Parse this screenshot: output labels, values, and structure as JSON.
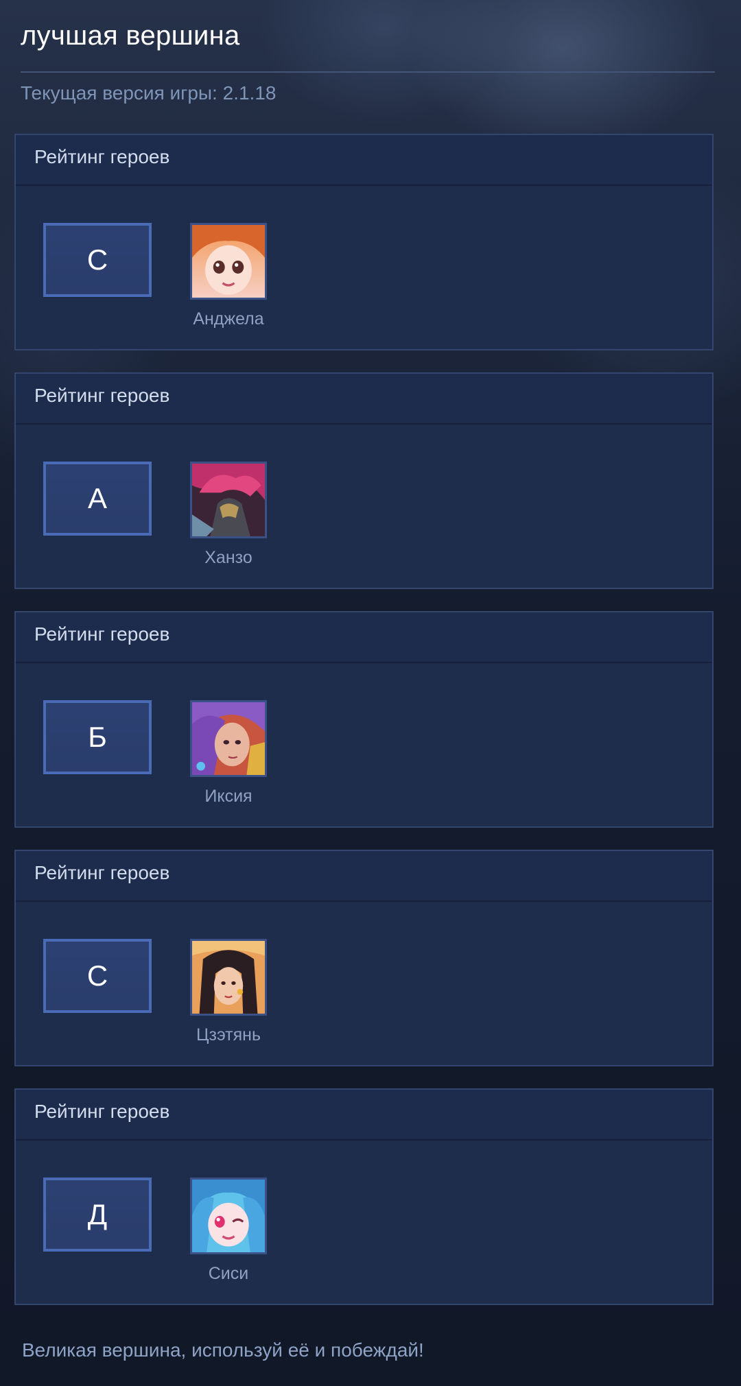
{
  "header": {
    "title": "лучшая вершина",
    "version_text": "Текущая версия игры: 2.1.18"
  },
  "cards": [
    {
      "title": "Рейтинг героев",
      "tier": "С",
      "hero": {
        "name": "Анджела",
        "portrait_icon": "angela-portrait"
      }
    },
    {
      "title": "Рейтинг героев",
      "tier": "А",
      "hero": {
        "name": "Ханзо",
        "portrait_icon": "hanzo-portrait"
      }
    },
    {
      "title": "Рейтинг героев",
      "tier": "Б",
      "hero": {
        "name": "Иксия",
        "portrait_icon": "ixia-portrait"
      }
    },
    {
      "title": "Рейтинг героев",
      "tier": "С",
      "hero": {
        "name": "Цзэтянь",
        "portrait_icon": "zetian-portrait"
      }
    },
    {
      "title": "Рейтинг героев",
      "tier": "Д",
      "hero": {
        "name": "Сиси",
        "portrait_icon": "cici-portrait"
      }
    }
  ],
  "footer": {
    "text": "Великая вершина, используй её и побеждай!"
  },
  "colors": {
    "tier_border": "#4a6bb6",
    "card_bg": "#1e2b4a",
    "accent_text": "#7f95b8"
  }
}
